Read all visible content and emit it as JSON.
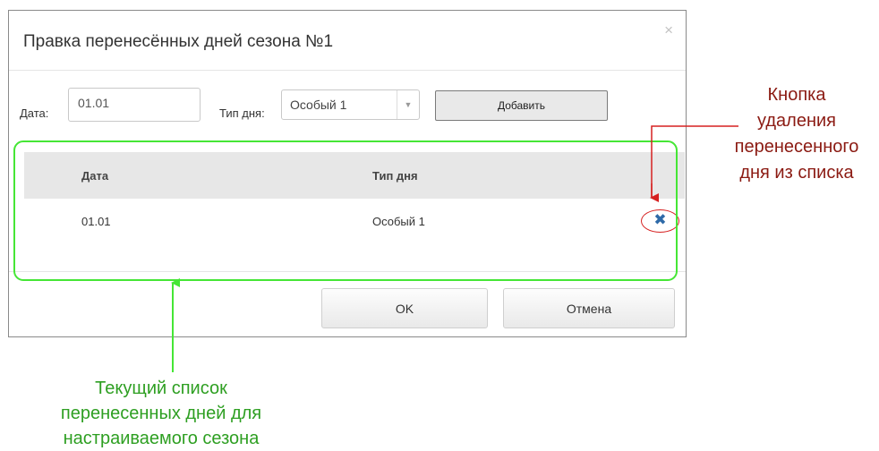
{
  "dialog": {
    "title": "Правка перенесённых дней сезона №1",
    "close_icon": "×",
    "date_label": "Дата:",
    "date_value": "01.01",
    "day_type_label": "Тип дня:",
    "day_type_value": "Особый 1",
    "add_button": "Добавить",
    "ok_button": "OK",
    "cancel_button": "Отмена"
  },
  "table": {
    "columns": [
      "Дата",
      "Тип дня"
    ],
    "rows": [
      {
        "date": "01.01",
        "day_type": "Особый 1",
        "delete_icon": "✖"
      }
    ]
  },
  "annotations": {
    "delete_button_note": [
      "Кнопка",
      "удаления",
      "перенесенного",
      "дня из списка"
    ],
    "list_note": [
      "Текущий список",
      "перенесенных дней для",
      "настраиваемого сезона"
    ],
    "colors": {
      "delete_note": "#8b1a12",
      "list_note": "#2e9f22",
      "highlight_green": "#45e635",
      "highlight_red": "#d62020"
    }
  }
}
